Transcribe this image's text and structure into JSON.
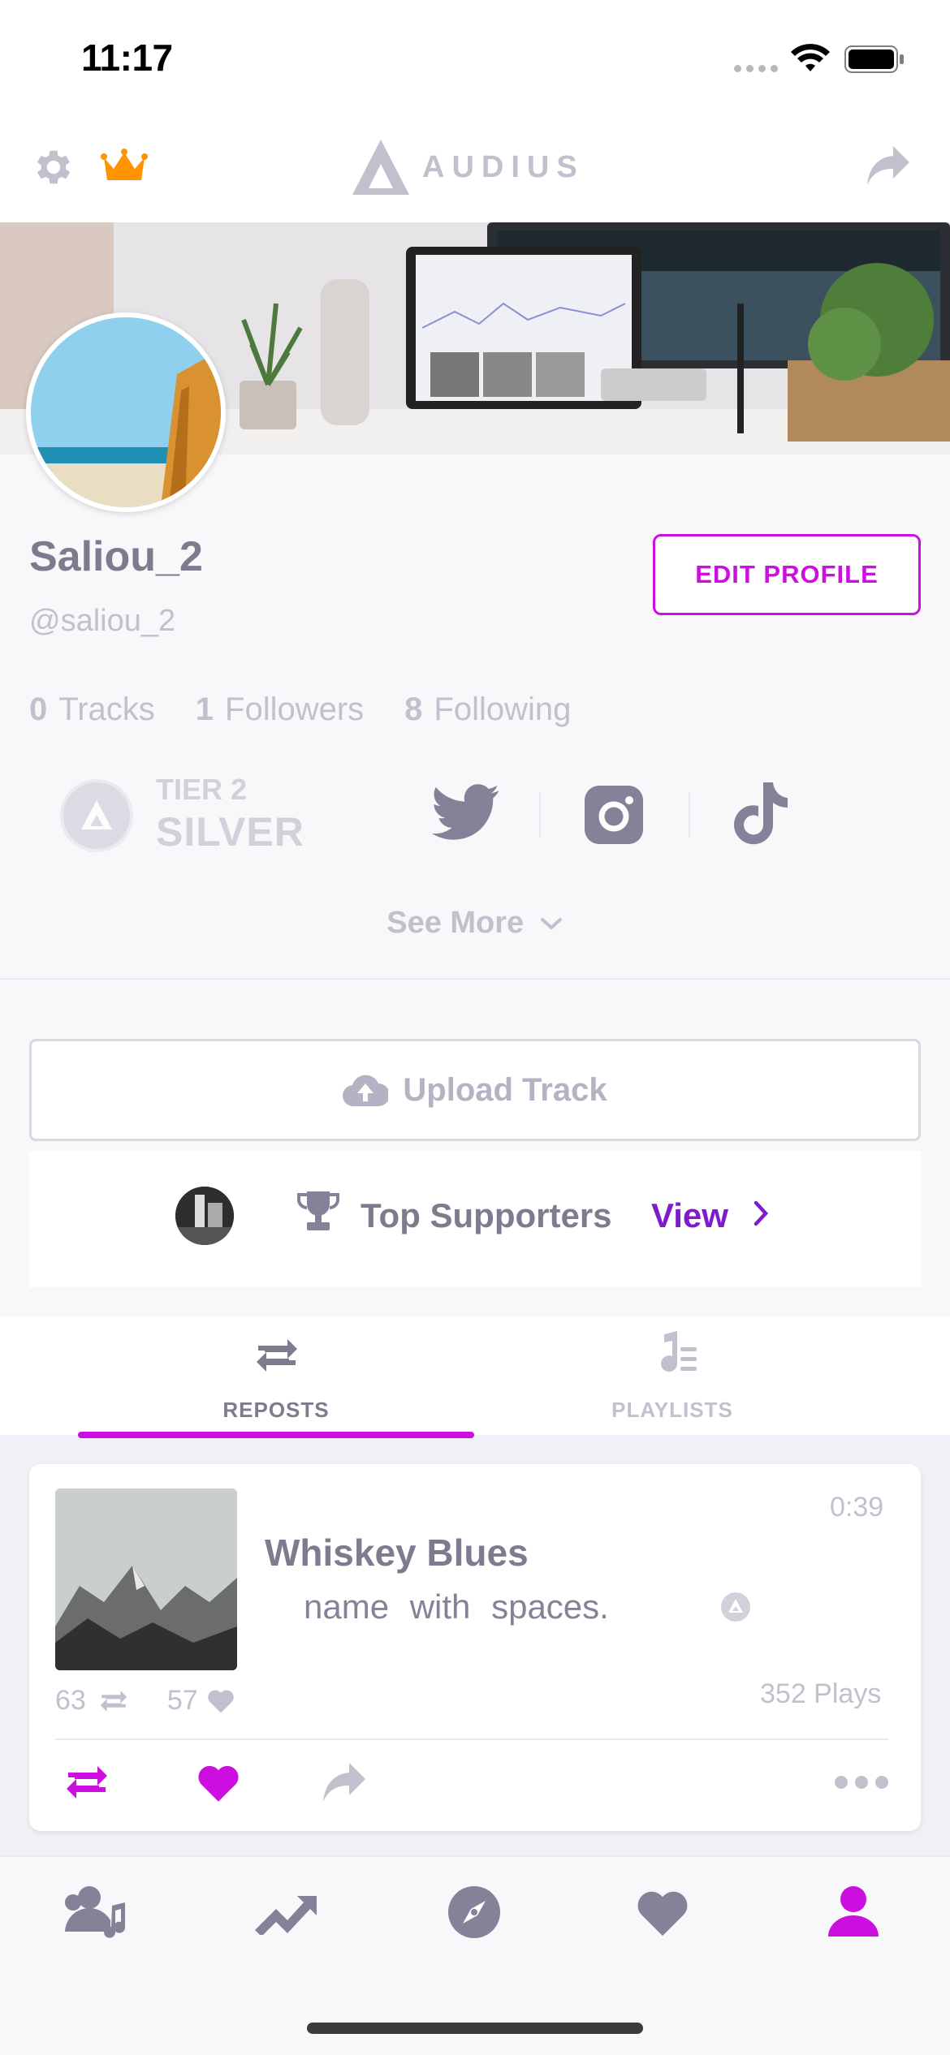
{
  "status_bar": {
    "time": "11:17"
  },
  "header": {
    "logo_text": "AUDIUS"
  },
  "profile": {
    "display_name": "Saliou_2",
    "handle": "@saliou_2",
    "edit_profile_label": "EDIT PROFILE",
    "stats": [
      {
        "count": "0",
        "label": "Tracks"
      },
      {
        "count": "1",
        "label": "Followers"
      },
      {
        "count": "8",
        "label": "Following"
      }
    ],
    "tier": {
      "line1": "TIER 2",
      "line2": "SILVER"
    },
    "see_more_label": "See More"
  },
  "upload": {
    "label": "Upload Track"
  },
  "supporters": {
    "label": "Top Supporters",
    "view_label": "View"
  },
  "tabs": [
    {
      "label": "REPOSTS",
      "active": true
    },
    {
      "label": "PLAYLISTS",
      "active": false
    }
  ],
  "track": {
    "title": "Whiskey Blues",
    "artist": "name with spaces.",
    "duration": "0:39",
    "repost_count": "63",
    "favorite_count": "57",
    "plays": "352 Plays"
  },
  "colors": {
    "accent": "#cc0fe0",
    "purple": "#7e1bcc",
    "crown": "#ff9400",
    "text_muted": "#c2c0cc",
    "text_primary": "#7e7b8f"
  },
  "icons": {
    "settings": "gear-icon",
    "crown": "crown-icon",
    "share": "share-icon",
    "upload": "cloud-upload-icon",
    "trophy": "trophy-icon",
    "repost": "repost-icon",
    "playlists": "playlists-icon",
    "heart": "heart-icon",
    "more": "more-icon",
    "feed": "feed-icon",
    "trending": "trending-icon",
    "explore": "explore-icon",
    "favorites": "favorites-icon",
    "profile": "profile-icon"
  }
}
